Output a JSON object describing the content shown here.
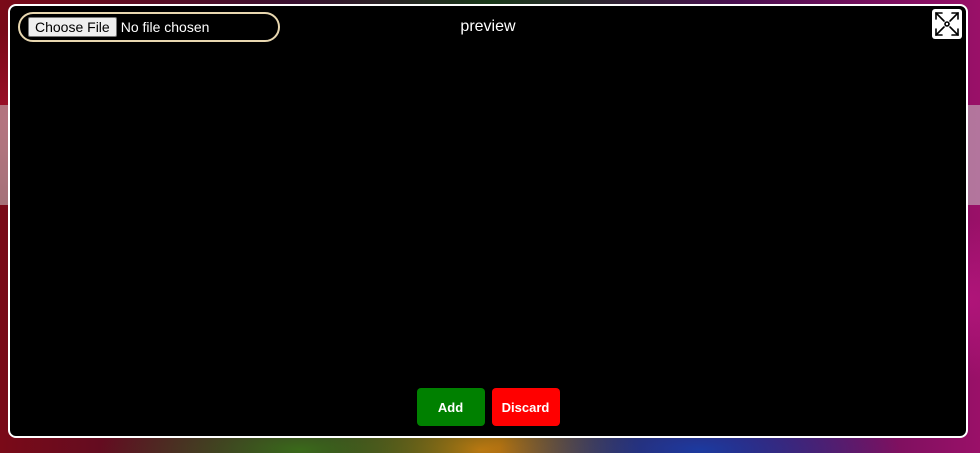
{
  "uploader": {
    "choose_label": "Choose File",
    "status": "No file chosen"
  },
  "modal": {
    "title": "preview"
  },
  "actions": {
    "add_label": "Add",
    "discard_label": "Discard"
  },
  "colors": {
    "add": "#008000",
    "discard": "#ff0000",
    "modal_bg": "#000000",
    "file_border": "#e8d7b0"
  },
  "icons": {
    "expand": "fullscreen-expand-icon"
  }
}
